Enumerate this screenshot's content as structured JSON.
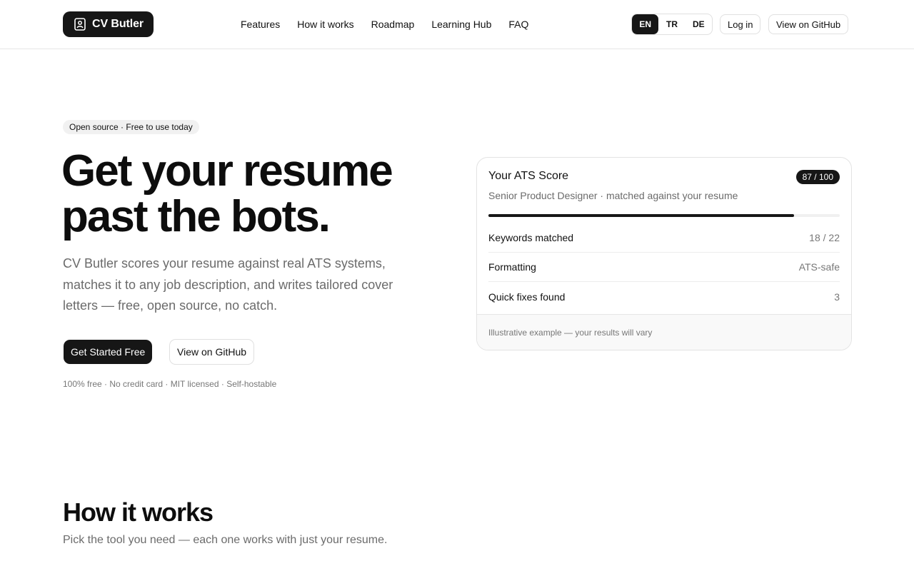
{
  "header": {
    "logo_label": "CV Butler",
    "nav": [
      "Features",
      "How it works",
      "Roadmap",
      "Learning Hub",
      "FAQ"
    ],
    "languages": [
      "EN",
      "TR",
      "DE"
    ],
    "active_language": "EN",
    "login_label": "Log in",
    "github_label": "View on GitHub"
  },
  "hero": {
    "badge": "Open source · Free to use today",
    "title_line1": "Get your resume",
    "title_line2": "past the bots.",
    "subtitle": "CV Butler scores your resume against real ATS systems, matches it to any job description, and writes tailored cover letters — free, open source, no catch.",
    "cta_primary": "Get Started Free",
    "cta_secondary": "View on GitHub",
    "fineprint": "100% free · No credit card · MIT licensed · Self-hostable"
  },
  "ats_card": {
    "title": "Your ATS Score",
    "score_label": "87 / 100",
    "score_fraction": 0.87,
    "subtitle": "Senior Product Designer · matched against your resume",
    "metrics": [
      {
        "label": "Keywords matched",
        "value": "18 / 22"
      },
      {
        "label": "Formatting",
        "value": "ATS-safe"
      },
      {
        "label": "Quick fixes found",
        "value": "3"
      }
    ],
    "footer": "Illustrative example — your results will vary"
  },
  "how_it_works": {
    "title": "How it works",
    "subtitle": "Pick the tool you need — each one works with just your resume."
  },
  "colors": {
    "accent_dark": "#161616",
    "muted_text": "#6b6b6b",
    "border": "#e3e3e3"
  }
}
